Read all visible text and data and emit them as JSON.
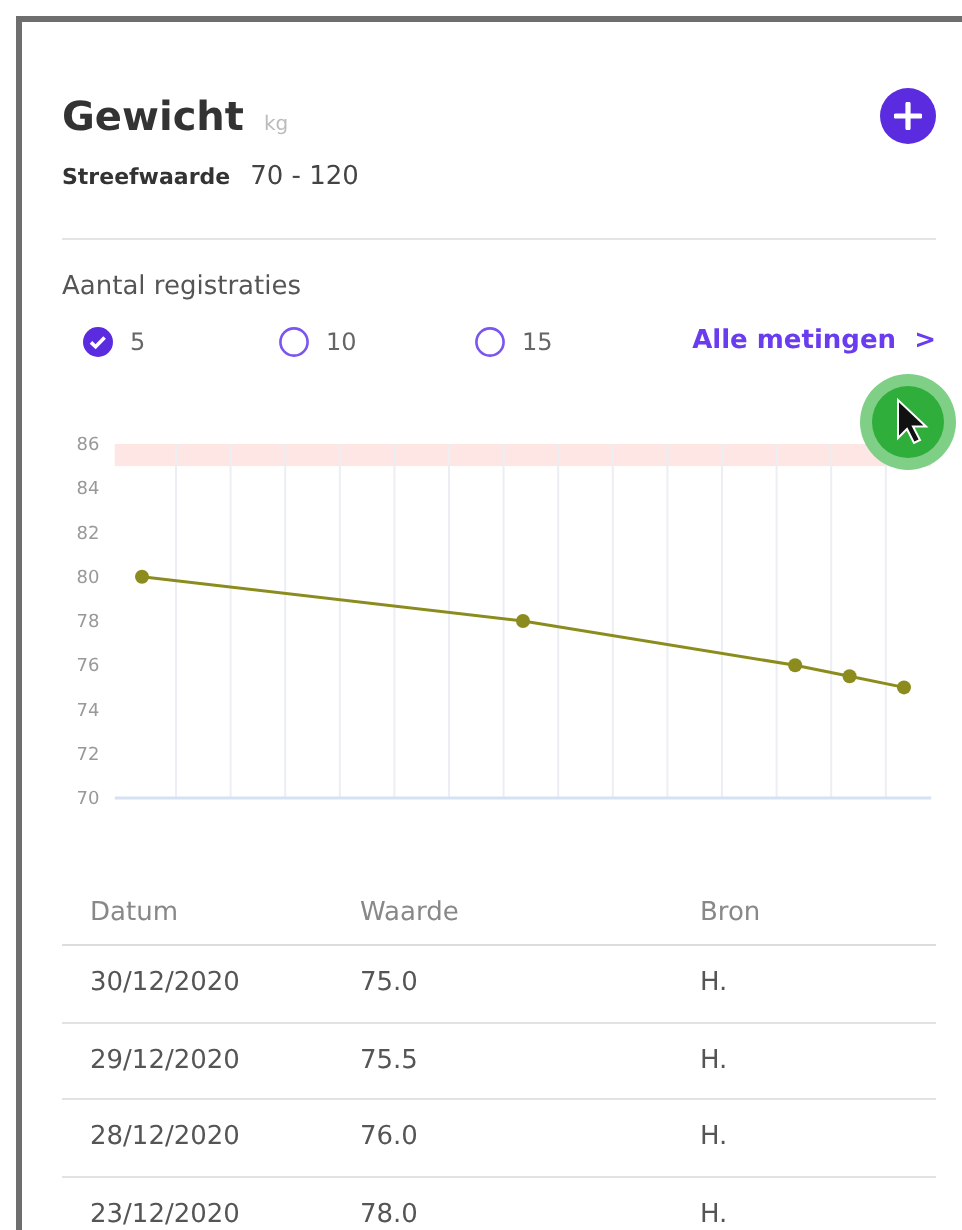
{
  "header": {
    "title": "Gewicht",
    "unit": "kg",
    "target_label": "Streefwaarde",
    "target_value": "70 - 120"
  },
  "count_selector": {
    "label": "Aantal registraties",
    "options": [
      {
        "label": "5",
        "selected": true
      },
      {
        "label": "10",
        "selected": false
      },
      {
        "label": "15",
        "selected": false
      }
    ],
    "link": "Alle metingen",
    "link_arrow": ">"
  },
  "pointer": {
    "shown": true
  },
  "chart_data": {
    "type": "line",
    "categories": [
      null,
      null,
      null,
      null,
      null,
      null,
      null,
      null,
      null,
      null,
      null,
      null,
      null,
      null,
      null
    ],
    "ylim": [
      70,
      86
    ],
    "yticks": [
      70,
      72,
      74,
      76,
      78,
      80,
      82,
      84,
      86
    ],
    "series": [
      {
        "color": "#8c8c1e",
        "marker": "circle",
        "values": [
          80,
          null,
          null,
          null,
          null,
          null,
          null,
          78,
          null,
          null,
          null,
          null,
          76,
          75.5,
          75
        ]
      }
    ],
    "bands": [
      {
        "axis": "y",
        "from": 85,
        "to": 86,
        "color": "#fde6e3"
      }
    ]
  },
  "table": {
    "columns": [
      "Datum",
      "Waarde",
      "Bron"
    ],
    "rows": [
      [
        "30/12/2020",
        "75.0",
        "H."
      ],
      [
        "29/12/2020",
        "75.5",
        "H."
      ],
      [
        "28/12/2020",
        "76.0",
        "H."
      ],
      [
        "23/12/2020",
        "78.0",
        "H."
      ]
    ]
  }
}
